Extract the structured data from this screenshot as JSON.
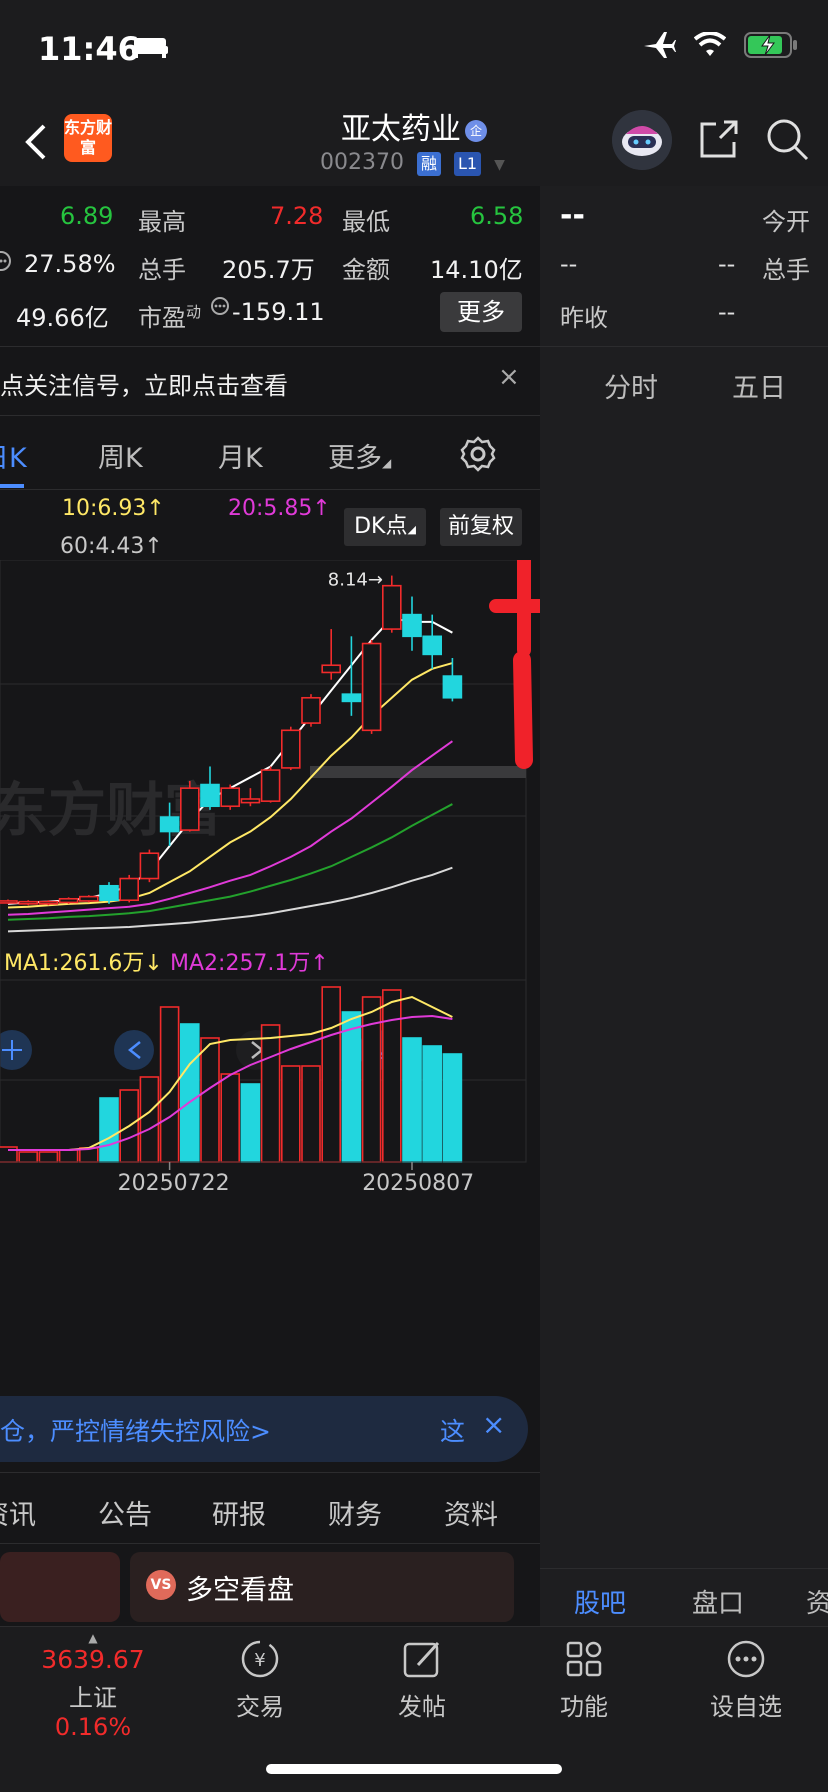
{
  "status": {
    "time": "11:46"
  },
  "header": {
    "logo_text": "东方财富",
    "stock_name": "亚太药业",
    "stock_badge": "企",
    "stock_code": "002370",
    "tag_rong": "融",
    "tag_l1": "L1"
  },
  "quote": {
    "open_val": "6.89",
    "high_label": "最高",
    "high_val": "7.28",
    "low_label": "最低",
    "low_val": "6.58",
    "turnover_val": "27.58%",
    "volume_label": "总手",
    "volume_val": "205.7万",
    "amount_label": "金额",
    "amount_val": "14.10亿",
    "mktcap_val": "49.66亿",
    "pe_label": "市盈",
    "pe_sup": "动",
    "pe_val": "-159.11",
    "more_button": "更多"
  },
  "right_panel": {
    "price": "--",
    "open_label": "今开",
    "v1": "--",
    "v2": "--",
    "volume_label": "总手",
    "prev_close_label": "昨收",
    "prev_close_val": "--",
    "tab_timeshare": "分时",
    "tab_fiveday": "五日",
    "bottom_tab_guba": "股吧",
    "bottom_tab_pankou": "盘口",
    "bottom_tab_zi": "资"
  },
  "notice": {
    "text": "点关注信号，立即点击查看",
    "close": "×"
  },
  "ktabs": {
    "day": "日K",
    "week": "周K",
    "month": "月K",
    "more": "更多"
  },
  "ma": {
    "ma10": "10:6.93↑",
    "ma20": "20:5.85↑",
    "ma60": "60:4.43↑",
    "dk_button": "DK点",
    "fq_button": "前复权",
    "vol_ma1": "MA1:261.6万↓",
    "vol_ma2": "MA2:257.1万↑"
  },
  "colors": {
    "up": "#f12b2b",
    "down": "#22d6de",
    "ma5": "#ffffff",
    "ma10": "#ffe866",
    "ma20": "#e03ad8",
    "ma30": "#23a12c",
    "ma60": "#d8d8d8"
  },
  "chart_data": {
    "type": "candlestick",
    "watermark": "东方财富",
    "peak_label": "8.14→",
    "x_tick_labels": [
      "20250722",
      "20250807"
    ],
    "candles": [
      {
        "o": 3.62,
        "c": 3.64,
        "h": 3.66,
        "l": 3.6
      },
      {
        "o": 3.6,
        "c": 3.63,
        "h": 3.65,
        "l": 3.58
      },
      {
        "o": 3.6,
        "c": 3.63,
        "h": 3.65,
        "l": 3.58
      },
      {
        "o": 3.62,
        "c": 3.67,
        "h": 3.69,
        "l": 3.6
      },
      {
        "o": 3.64,
        "c": 3.7,
        "h": 3.72,
        "l": 3.62
      },
      {
        "o": 3.85,
        "c": 3.65,
        "h": 3.9,
        "l": 3.6
      },
      {
        "o": 3.65,
        "c": 3.95,
        "h": 4.0,
        "l": 3.62
      },
      {
        "o": 3.95,
        "c": 4.3,
        "h": 4.35,
        "l": 3.9
      },
      {
        "o": 4.8,
        "c": 4.6,
        "h": 5.0,
        "l": 4.4
      },
      {
        "o": 4.62,
        "c": 5.2,
        "h": 5.3,
        "l": 4.6
      },
      {
        "o": 5.25,
        "c": 4.95,
        "h": 5.5,
        "l": 4.9
      },
      {
        "o": 4.95,
        "c": 5.2,
        "h": 5.25,
        "l": 4.9
      },
      {
        "o": 5.0,
        "c": 5.05,
        "h": 5.2,
        "l": 4.95
      },
      {
        "o": 5.02,
        "c": 5.45,
        "h": 5.5,
        "l": 5.0
      },
      {
        "o": 5.48,
        "c": 6.0,
        "h": 6.05,
        "l": 5.45
      },
      {
        "o": 6.1,
        "c": 6.45,
        "h": 6.5,
        "l": 6.05
      },
      {
        "o": 6.8,
        "c": 6.9,
        "h": 7.4,
        "l": 6.7
      },
      {
        "o": 6.5,
        "c": 6.4,
        "h": 7.3,
        "l": 6.2
      },
      {
        "o": 6.0,
        "c": 7.2,
        "h": 7.25,
        "l": 5.95
      },
      {
        "o": 7.4,
        "c": 8.0,
        "h": 8.14,
        "l": 7.35
      },
      {
        "o": 7.6,
        "c": 7.3,
        "h": 7.85,
        "l": 7.1
      },
      {
        "o": 7.3,
        "c": 7.05,
        "h": 7.6,
        "l": 6.85
      },
      {
        "o": 6.75,
        "c": 6.45,
        "h": 7.0,
        "l": 6.4
      }
    ],
    "ma5": [
      3.6,
      3.62,
      3.63,
      3.65,
      3.68,
      3.75,
      3.85,
      4.05,
      4.4,
      4.75,
      5.05,
      5.2,
      5.35,
      5.5,
      5.85,
      6.2,
      6.55,
      6.9,
      7.25,
      7.55,
      7.5,
      7.5,
      7.35
    ],
    "ma10": [
      3.55,
      3.56,
      3.58,
      3.6,
      3.61,
      3.63,
      3.67,
      3.75,
      3.9,
      4.05,
      4.25,
      4.45,
      4.6,
      4.8,
      5.05,
      5.35,
      5.65,
      5.9,
      6.2,
      6.45,
      6.7,
      6.85,
      6.93
    ],
    "ma20": [
      3.45,
      3.46,
      3.48,
      3.5,
      3.52,
      3.54,
      3.56,
      3.6,
      3.67,
      3.75,
      3.83,
      3.92,
      4.0,
      4.12,
      4.25,
      4.4,
      4.6,
      4.78,
      5.0,
      5.22,
      5.45,
      5.65,
      5.85
    ],
    "ma30": [
      3.38,
      3.39,
      3.4,
      3.42,
      3.43,
      3.45,
      3.47,
      3.5,
      3.55,
      3.6,
      3.65,
      3.7,
      3.77,
      3.85,
      3.93,
      4.02,
      4.12,
      4.25,
      4.38,
      4.52,
      4.68,
      4.83,
      4.98
    ],
    "ma60": [
      3.22,
      3.23,
      3.24,
      3.25,
      3.26,
      3.27,
      3.28,
      3.3,
      3.32,
      3.34,
      3.37,
      3.4,
      3.43,
      3.47,
      3.52,
      3.57,
      3.62,
      3.68,
      3.75,
      3.83,
      3.92,
      4.0,
      4.1
    ],
    "ylim": [
      3.1,
      8.3
    ],
    "volume": {
      "values": [
        15,
        10,
        10,
        12,
        14,
        64,
        72,
        85,
        155,
        138,
        124,
        88,
        78,
        137,
        96,
        96,
        175,
        150,
        165,
        172,
        124,
        116,
        108
      ],
      "up": [
        true,
        true,
        true,
        true,
        true,
        false,
        true,
        true,
        true,
        false,
        true,
        true,
        false,
        true,
        true,
        true,
        true,
        false,
        true,
        true,
        false,
        false,
        false
      ],
      "ma1": [
        12,
        12,
        12,
        12,
        14,
        24,
        36,
        50,
        70,
        98,
        118,
        122,
        123,
        124,
        126,
        128,
        134,
        143,
        150,
        160,
        165,
        155,
        145
      ],
      "ma2": [
        12,
        12,
        12,
        12,
        13,
        17,
        24,
        33,
        45,
        60,
        74,
        87,
        97,
        105,
        113,
        120,
        127,
        133,
        138,
        142,
        145,
        146,
        143
      ],
      "ylim": [
        0,
        180
      ]
    }
  },
  "warning": {
    "text": "仓，严控情绪失控风险>",
    "link": "这",
    "close": "×"
  },
  "news_tabs": [
    "资讯",
    "公告",
    "研报",
    "财务",
    "资料"
  ],
  "card": {
    "icon": "VS",
    "title": "多空看盘"
  },
  "bottom": {
    "index_val": "3639.67",
    "index_name": "上证",
    "index_pct": "0.16%",
    "trade": "交易",
    "post": "发帖",
    "func": "功能",
    "watch": "设自选"
  }
}
